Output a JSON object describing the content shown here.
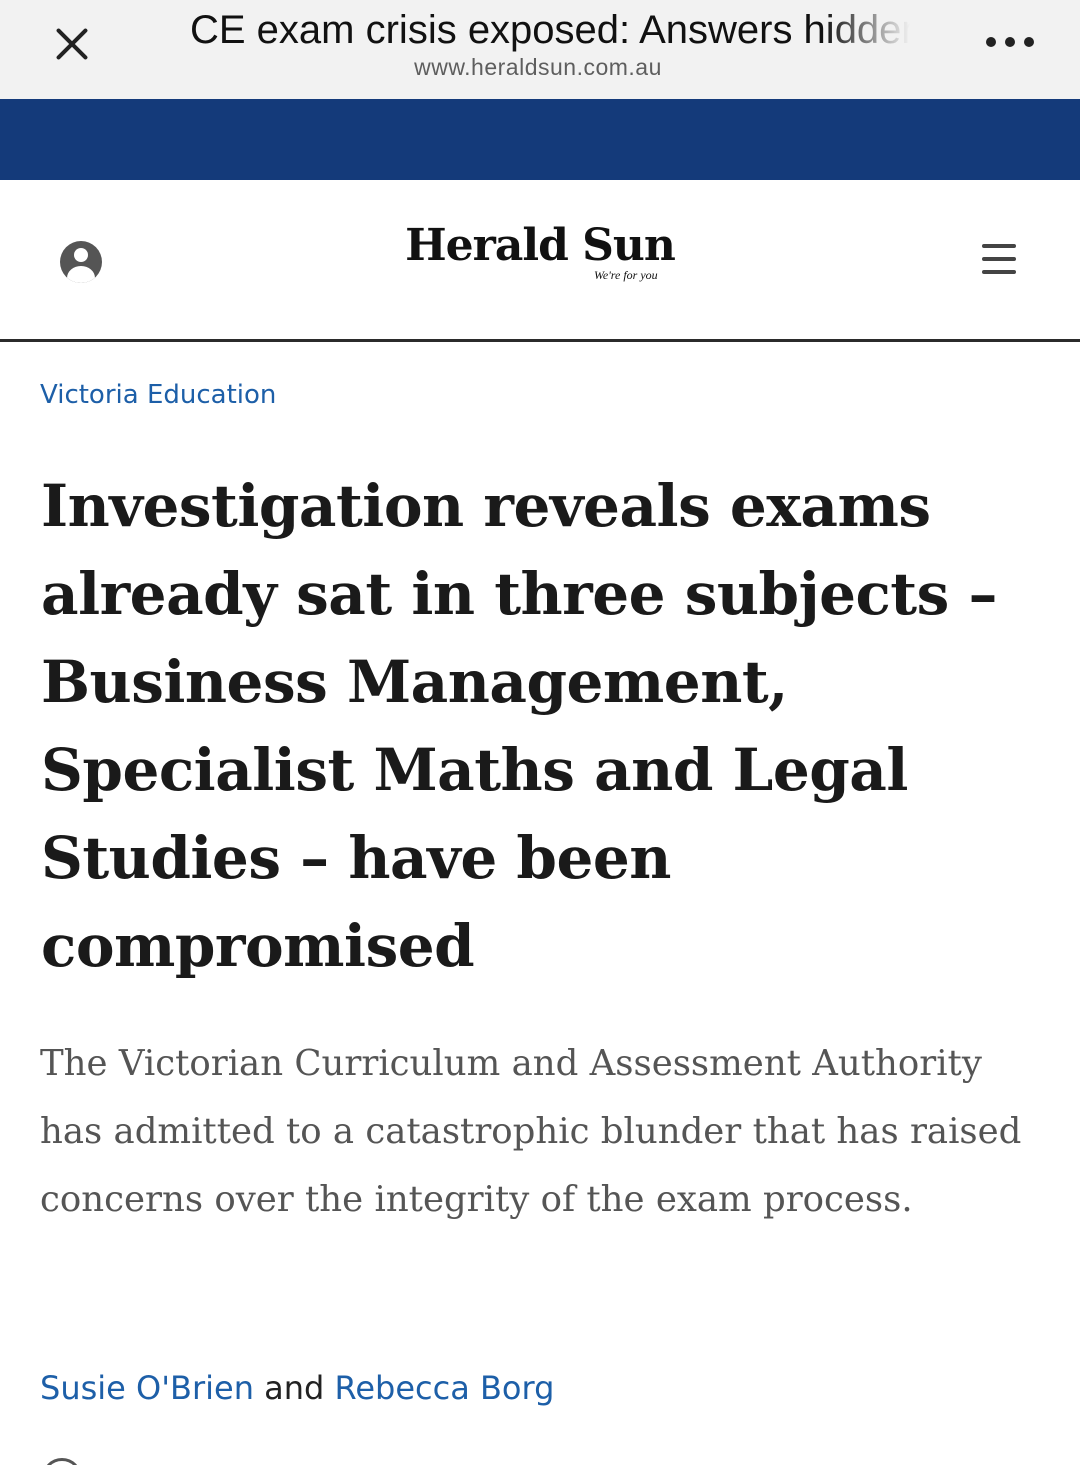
{
  "browser": {
    "page_title": "CE exam crisis exposed: Answers hidden",
    "url": "www.heraldsun.com.au"
  },
  "site": {
    "name": "Herald Sun",
    "tagline": "We're for you"
  },
  "article": {
    "category": "Victoria Education",
    "headline": "Investigation reveals exams already sat in three subjects – Business Management, Specialist Maths and Legal Studies – have been compromised",
    "standfirst": "The Victorian Curriculum and Assessment Authority has admitted to a catastrophic blunder that has raised concerns over the integrity of the exam process.",
    "authors": [
      "Susie O'Brien",
      "Rebecca Borg"
    ],
    "author_joiner": "and"
  },
  "colors": {
    "banner": "#143a7a",
    "link": "#1d5fa8",
    "topbar": "#f2f2f2"
  },
  "icons": {
    "close": "close-icon",
    "more": "more-options-icon",
    "account": "user-account-icon",
    "menu": "hamburger-menu-icon"
  }
}
